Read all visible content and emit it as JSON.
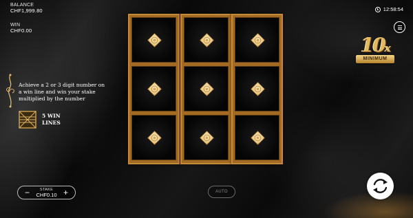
{
  "balance": {
    "label": "BALANCE",
    "value": "CHF1,999.80"
  },
  "win": {
    "label": "WIN",
    "value": "CHF0.00"
  },
  "clock": {
    "time": "12:58:54",
    "icon": "clock-icon"
  },
  "menu": {
    "icon": "hamburger-menu-icon"
  },
  "badge": {
    "multiplier": "10",
    "suffix": "x",
    "caption": "MINIMUM"
  },
  "promo": {
    "text": "Achieve a 2 or 3 digit number on a win line and win your stake multiplied by the number",
    "lines_label": "5 WIN LINES"
  },
  "reels": {
    "columns": 3,
    "rows": 3,
    "symbol": "gold-diamond-seal-symbol"
  },
  "controls": {
    "stake_label": "STAKE",
    "stake_value": "CHF0.10",
    "minus": "−",
    "plus": "+",
    "auto_label": "AUTO",
    "spin_icon": "refresh-spin-icon"
  },
  "colors": {
    "gold": "#c28a3a",
    "gold_light": "#f3d487",
    "background": "#111111"
  }
}
